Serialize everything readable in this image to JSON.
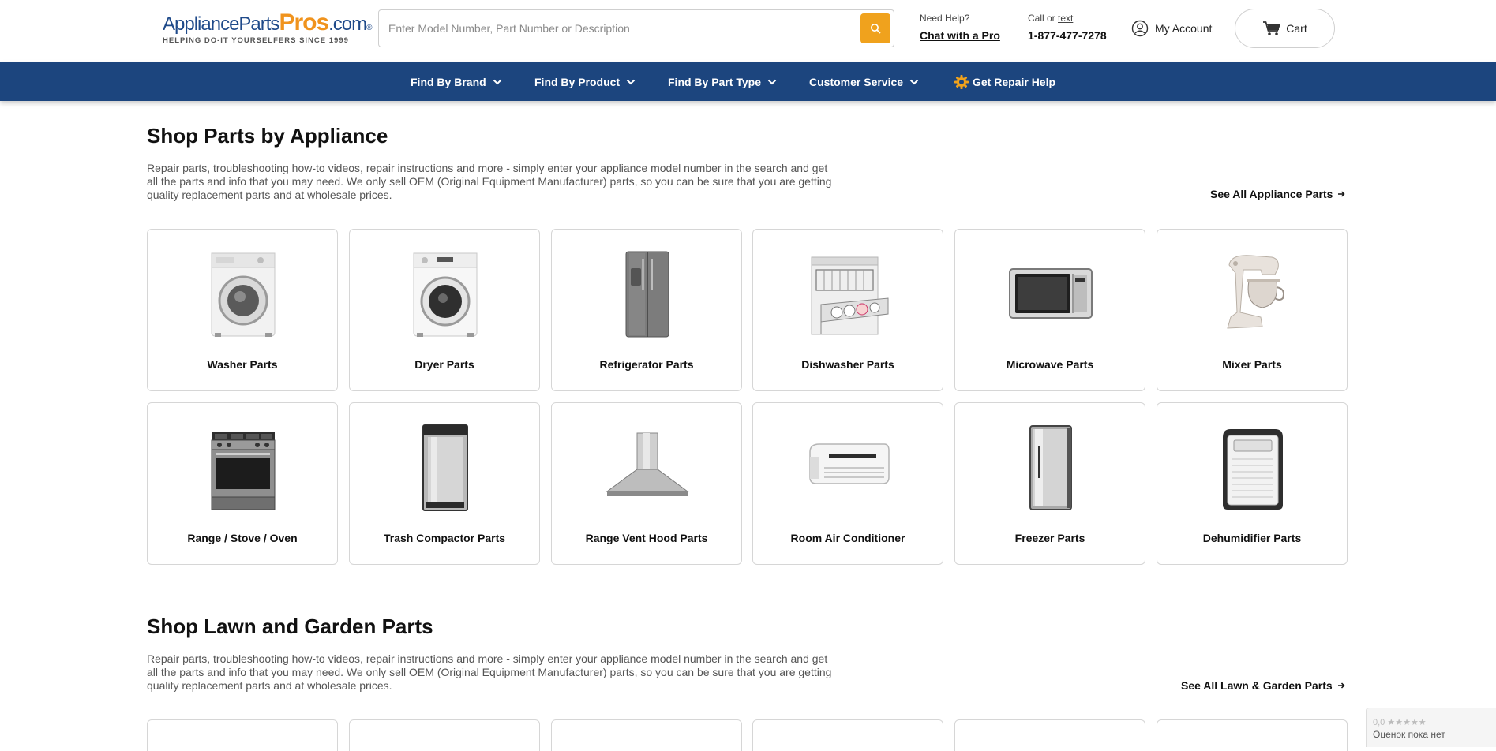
{
  "header": {
    "logo": {
      "part1": "ApplianceParts",
      "part2": "Pros",
      "part3": ".com",
      "registered": "®",
      "tagline": "HELPING DO-IT YOURSELFERS SINCE 1999"
    },
    "search": {
      "placeholder": "Enter Model Number, Part Number or Description"
    },
    "help": {
      "label": "Need Help?",
      "link": "Chat with a Pro"
    },
    "call": {
      "label_prefix": "Call or ",
      "label_link": "text",
      "phone": "1-877-477-7278"
    },
    "account_label": "My Account",
    "cart_label": "Cart"
  },
  "nav": {
    "items": [
      {
        "label": "Find By Brand"
      },
      {
        "label": "Find By Product"
      },
      {
        "label": "Find By Part Type"
      },
      {
        "label": "Customer Service"
      },
      {
        "label": "Get Repair Help"
      }
    ]
  },
  "appliance_section": {
    "title": "Shop Parts by Appliance",
    "description": "Repair parts, troubleshooting how-to videos, repair instructions and more - simply enter your appliance model number in the search and get all the parts and info that you may need. We only sell OEM (Original Equipment Manufacturer) parts, so you can be sure that you are getting quality replacement parts and at wholesale prices.",
    "see_all": "See All Appliance Parts",
    "cards": [
      {
        "label": "Washer Parts"
      },
      {
        "label": "Dryer Parts"
      },
      {
        "label": "Refrigerator Parts"
      },
      {
        "label": "Dishwasher Parts"
      },
      {
        "label": "Microwave Parts"
      },
      {
        "label": "Mixer Parts"
      },
      {
        "label": "Range / Stove / Oven"
      },
      {
        "label": "Trash Compactor Parts"
      },
      {
        "label": "Range Vent Hood Parts"
      },
      {
        "label": "Room Air Conditioner"
      },
      {
        "label": "Freezer Parts"
      },
      {
        "label": "Dehumidifier Parts"
      }
    ]
  },
  "lawn_section": {
    "title": "Shop Lawn and Garden Parts",
    "description": "Repair parts, troubleshooting how-to videos, repair instructions and more - simply enter your appliance model number in the search and get all the parts and info that you may need. We only sell OEM (Original Equipment Manufacturer) parts, so you can be sure that you are getting quality replacement parts and at wholesale prices.",
    "see_all": "See All Lawn & Garden Parts"
  },
  "rating_widget": {
    "score": "0,0",
    "stars": "★★★★★",
    "text": "Оценок пока нет"
  },
  "colors": {
    "nav_bg": "#1c457e",
    "accent_orange": "#f0a21d",
    "logo_blue": "#1f4a8a"
  }
}
